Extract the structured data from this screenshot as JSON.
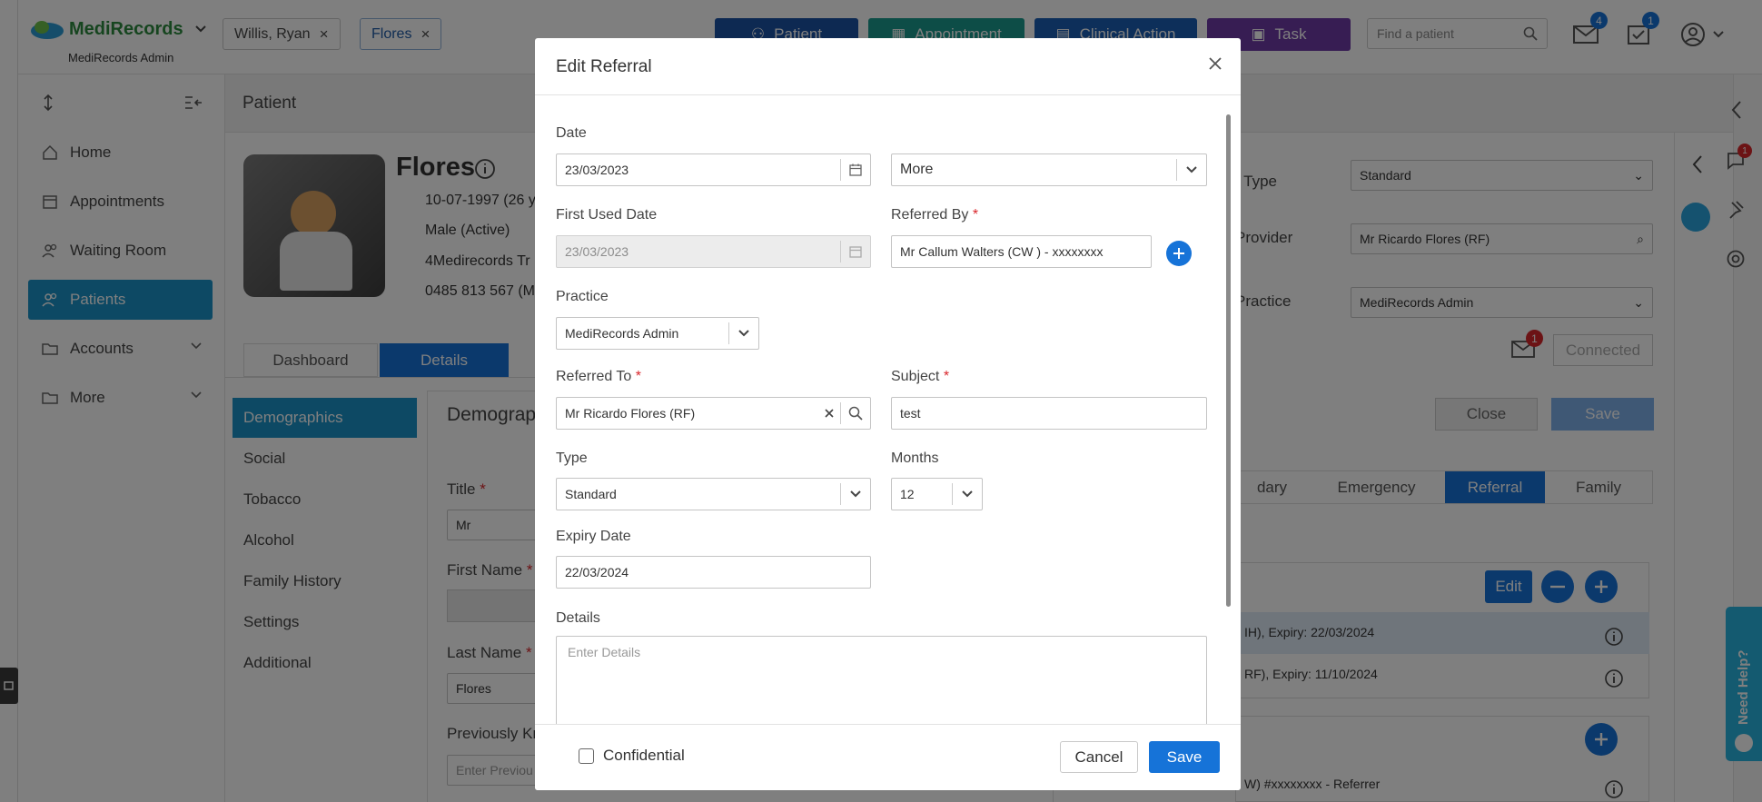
{
  "topbar": {
    "logo_text": "MediRecords",
    "logo_sub": "MediRecords Admin",
    "chips": [
      {
        "label": "Willis, Ryan"
      },
      {
        "label": "Flores"
      }
    ],
    "buttons": {
      "patient": "Patient",
      "appointment": "Appointment",
      "clinical_action": "Clinical Action",
      "task": "Task"
    },
    "search_placeholder": "Find a patient",
    "mail_badge": "4",
    "tasks_badge": "1",
    "colors": {
      "patient": "#1b52a4",
      "appointment": "#1b9a8e",
      "clinical_action": "#1a5fb4",
      "task": "#6e3aa7"
    }
  },
  "sidebar": {
    "items": [
      {
        "label": "Home",
        "icon": "home-icon"
      },
      {
        "label": "Appointments",
        "icon": "calendar-icon"
      },
      {
        "label": "Waiting Room",
        "icon": "people-icon"
      },
      {
        "label": "Patients",
        "icon": "people-icon"
      },
      {
        "label": "Accounts",
        "icon": "folder-icon"
      },
      {
        "label": "More",
        "icon": "folder-share-icon"
      }
    ]
  },
  "main": {
    "title": "Patient",
    "patient": {
      "name": "Flores",
      "dob": "10-07-1997 (26 y",
      "gender": "Male (Active)",
      "address": "4Medirecords Tr",
      "phone": "0485 813 567 (M"
    },
    "tabs": [
      "Dashboard",
      "Details"
    ],
    "subnav": [
      "Demographics",
      "Social",
      "Tobacco",
      "Alcohol",
      "Family History",
      "Settings",
      "Additional"
    ],
    "section_title": "Demograp",
    "form": {
      "title_label": "Title",
      "title_value": "Mr",
      "first_name_label": "First Name",
      "last_name_label": "Last Name",
      "last_name_value": "Flores",
      "prev_label": "Previously Kn",
      "prev_placeholder": "Enter Previou"
    },
    "right": {
      "type_label": "t Type",
      "type_value": "Standard",
      "provider_label": "Provider",
      "provider_value": "Mr Ricardo Flores (RF)",
      "practice_label": "Practice",
      "practice_value": "MediRecords Admin",
      "connected": "Connected",
      "msg_badge": "1",
      "close": "Close",
      "save": "Save",
      "tabs": [
        "dary",
        "Emergency",
        "Referral",
        "Family"
      ],
      "edit": "Edit",
      "rows": [
        "IH), Expiry: 22/03/2024",
        "RF), Expiry: 11/10/2024"
      ],
      "row3": "W) #xxxxxxxx - Referrer"
    },
    "rightbar_badge": "1"
  },
  "help": "Need Help?",
  "modal": {
    "title": "Edit Referral",
    "date_label": "Date",
    "date_value": "23/03/2023",
    "more_value": "More",
    "first_used_label": "First Used Date",
    "first_used_value": "23/03/2023",
    "referred_by_label": "Referred By",
    "referred_by_value": "Mr Callum Walters (CW ) - xxxxxxxx",
    "practice_label": "Practice",
    "practice_value": "MediRecords Admin",
    "referred_to_label": "Referred To",
    "referred_to_value": "Mr Ricardo Flores (RF)",
    "subject_label": "Subject",
    "subject_value": "test",
    "type_label": "Type",
    "type_value": "Standard",
    "months_label": "Months",
    "months_value": "12",
    "expiry_label": "Expiry Date",
    "expiry_value": "22/03/2024",
    "details_label": "Details",
    "details_placeholder": "Enter Details",
    "confidential_label": "Confidential",
    "cancel": "Cancel",
    "save": "Save",
    "required_mark": "*"
  }
}
